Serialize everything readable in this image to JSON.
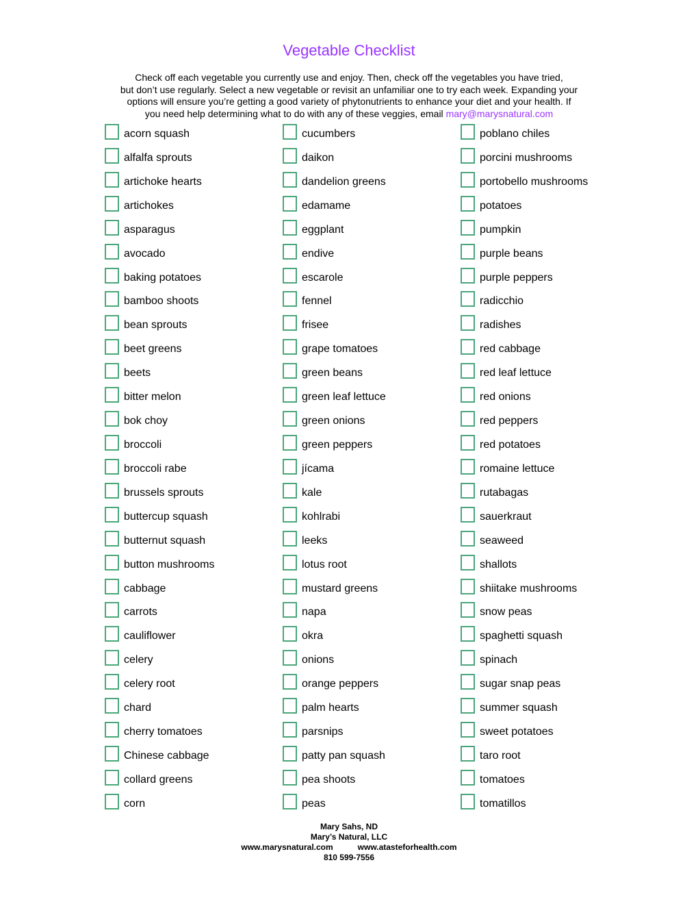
{
  "title": "Vegetable Checklist",
  "intro": {
    "line1": "Check off each vegetable you currently use and enjoy. Then, check off the vegetables you have tried,",
    "line2": "but don’t use regularly. Select a new vegetable or revisit an unfamiliar one to try each week. Expanding your",
    "line3": "options will ensure you’re getting a good variety of phytonutrients to enhance your diet and your health. If",
    "line4": "you need help determining what to do with any of these veggies, email ",
    "email": "mary@marysnatural.com"
  },
  "colors": {
    "accent": "#9933ff",
    "checkbox_border": "#4aa57a"
  },
  "columns": [
    [
      "acorn squash",
      "alfalfa sprouts",
      "artichoke hearts",
      "artichokes",
      "asparagus",
      "avocado",
      "baking potatoes",
      "bamboo shoots",
      "bean sprouts",
      "beet greens",
      "beets",
      "bitter melon",
      "bok choy",
      "broccoli",
      "broccoli rabe",
      "brussels sprouts",
      "buttercup squash",
      "butternut squash",
      "button mushrooms",
      "cabbage",
      "carrots",
      "cauliflower",
      "celery",
      "celery root",
      "chard",
      "cherry tomatoes",
      "Chinese cabbage",
      "collard greens",
      "corn"
    ],
    [
      "cucumbers",
      "daikon",
      "dandelion greens",
      "edamame",
      "eggplant",
      "endive",
      "escarole",
      "fennel",
      "frisee",
      "grape tomatoes",
      "green beans",
      "green leaf lettuce",
      "green onions",
      "green peppers",
      "jícama",
      "kale",
      "kohlrabi",
      "leeks",
      "lotus root",
      "mustard greens",
      "napa",
      "okra",
      "onions",
      "orange peppers",
      "palm hearts",
      "parsnips",
      "patty pan squash",
      "pea shoots",
      "peas"
    ],
    [
      "poblano chiles",
      "porcini mushrooms",
      "portobello mushrooms",
      "potatoes",
      "pumpkin",
      "purple beans",
      "purple peppers",
      "radicchio",
      "radishes",
      "red cabbage",
      "red leaf lettuce",
      "red onions",
      "red peppers",
      "red potatoes",
      "romaine lettuce",
      "rutabagas",
      "sauerkraut",
      "seaweed",
      "shallots",
      "shiitake mushrooms",
      "snow peas",
      "spaghetti squash",
      "spinach",
      "sugar snap peas",
      "summer squash",
      "sweet potatoes",
      "taro root",
      "tomatoes",
      "tomatillos"
    ]
  ],
  "footer": {
    "name": "Mary Sahs, ND",
    "company": "Mary’s Natural, LLC",
    "website1": "www.marysnatural.com",
    "website2": "www.atasteforhealth.com",
    "phone": "810 599-7556"
  }
}
